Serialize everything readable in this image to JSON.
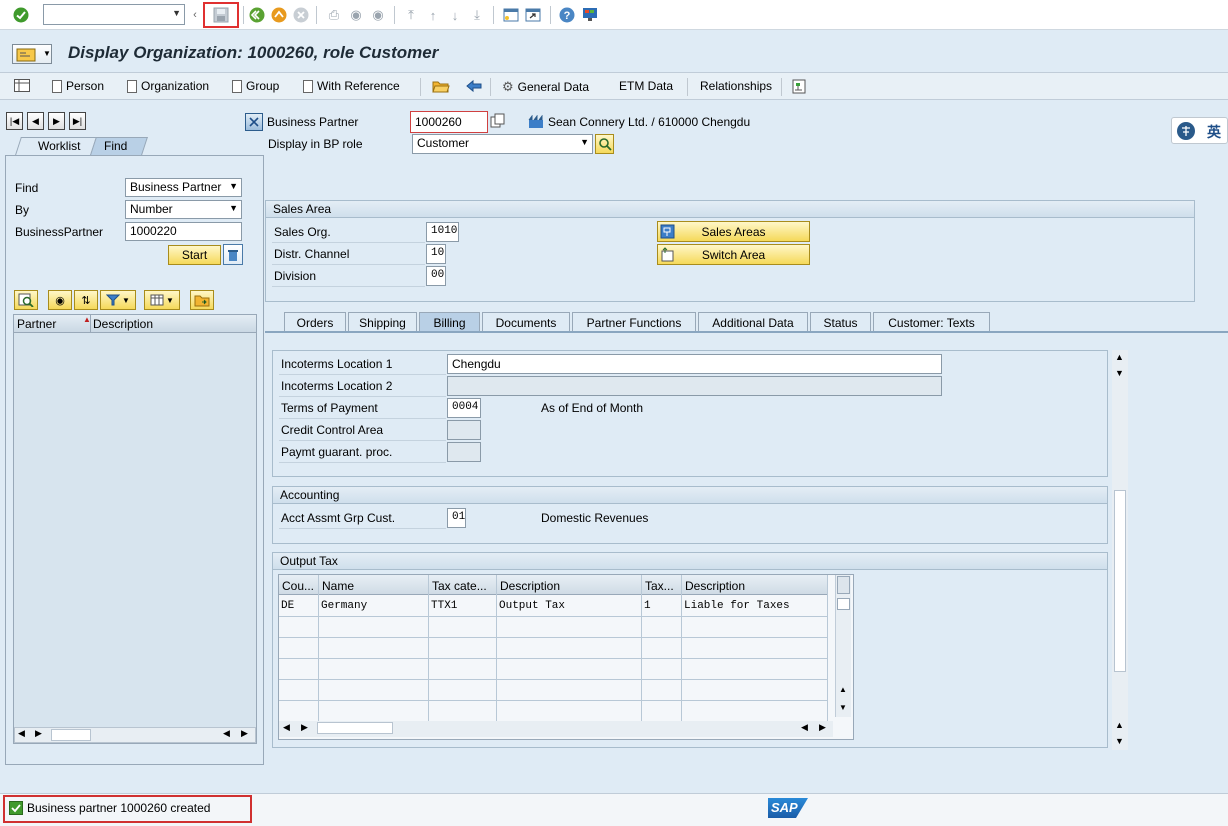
{
  "system_toolbar": {
    "command_field_value": "",
    "icons": [
      "enter-icon",
      "back-icon",
      "exit-icon",
      "cancel-icon",
      "print-icon",
      "find-icon",
      "find-next-icon",
      "first-page-icon",
      "previous-page-icon",
      "next-page-icon",
      "last-page-icon",
      "new-session-icon",
      "shortcut-icon",
      "help-icon",
      "customize-icon"
    ]
  },
  "title": "Display Organization: 1000260, role Customer",
  "app_toolbar": {
    "person": "Person",
    "organization": "Organization",
    "group": "Group",
    "with_reference": "With Reference",
    "general_data": "General Data",
    "etm_data": "ETM Data",
    "relationships": "Relationships"
  },
  "locator": {
    "tabs": [
      "Worklist",
      "Find"
    ],
    "active_tab": "Find",
    "find_label": "Find",
    "find_value": "Business Partner",
    "by_label": "By",
    "by_value": "Number",
    "bp_label": "BusinessPartner",
    "bp_value": "1000220",
    "start_button": "Start",
    "columns": [
      "Partner",
      "Description"
    ]
  },
  "header": {
    "bp_label": "Business Partner",
    "bp_value": "1000260",
    "bp_description": "Sean Connery Ltd. / 610000 Chengdu",
    "role_label": "Display in BP role",
    "role_value": "Customer"
  },
  "ime_label": "英",
  "sales_area": {
    "title": "Sales Area",
    "sales_org_label": "Sales Org.",
    "sales_org_value": "1010",
    "distr_channel_label": "Distr. Channel",
    "distr_channel_value": "10",
    "division_label": "Division",
    "division_value": "00",
    "sales_areas_button": "Sales Areas",
    "switch_area_button": "Switch Area"
  },
  "tabs": [
    "Orders",
    "Shipping",
    "Billing",
    "Documents",
    "Partner Functions",
    "Additional Data",
    "Status",
    "Customer: Texts"
  ],
  "active_tab": "Billing",
  "billing": {
    "incoterms_loc1_label": "Incoterms Location 1",
    "incoterms_loc1_value": "Chengdu",
    "incoterms_loc2_label": "Incoterms Location 2",
    "incoterms_loc2_value": "",
    "terms_payment_label": "Terms of Payment",
    "terms_payment_value": "0004",
    "terms_payment_text": "As of End of Month",
    "credit_control_label": "Credit Control Area",
    "credit_control_value": "",
    "paymt_guarant_label": "Paymt guarant. proc.",
    "paymt_guarant_value": ""
  },
  "accounting": {
    "title": "Accounting",
    "acct_assmt_label": "Acct Assmt Grp Cust.",
    "acct_assmt_value": "01",
    "acct_assmt_text": "Domestic Revenues"
  },
  "output_tax": {
    "title": "Output Tax",
    "columns": [
      "Cou...",
      "Name",
      "Tax cate...",
      "Description",
      "Tax...",
      "Description"
    ],
    "rows": [
      [
        "DE",
        "Germany",
        "TTX1",
        "Output Tax",
        "1",
        "Liable for Taxes"
      ]
    ]
  },
  "status": {
    "message": "Business partner 1000260 created",
    "logo": "SAP"
  }
}
